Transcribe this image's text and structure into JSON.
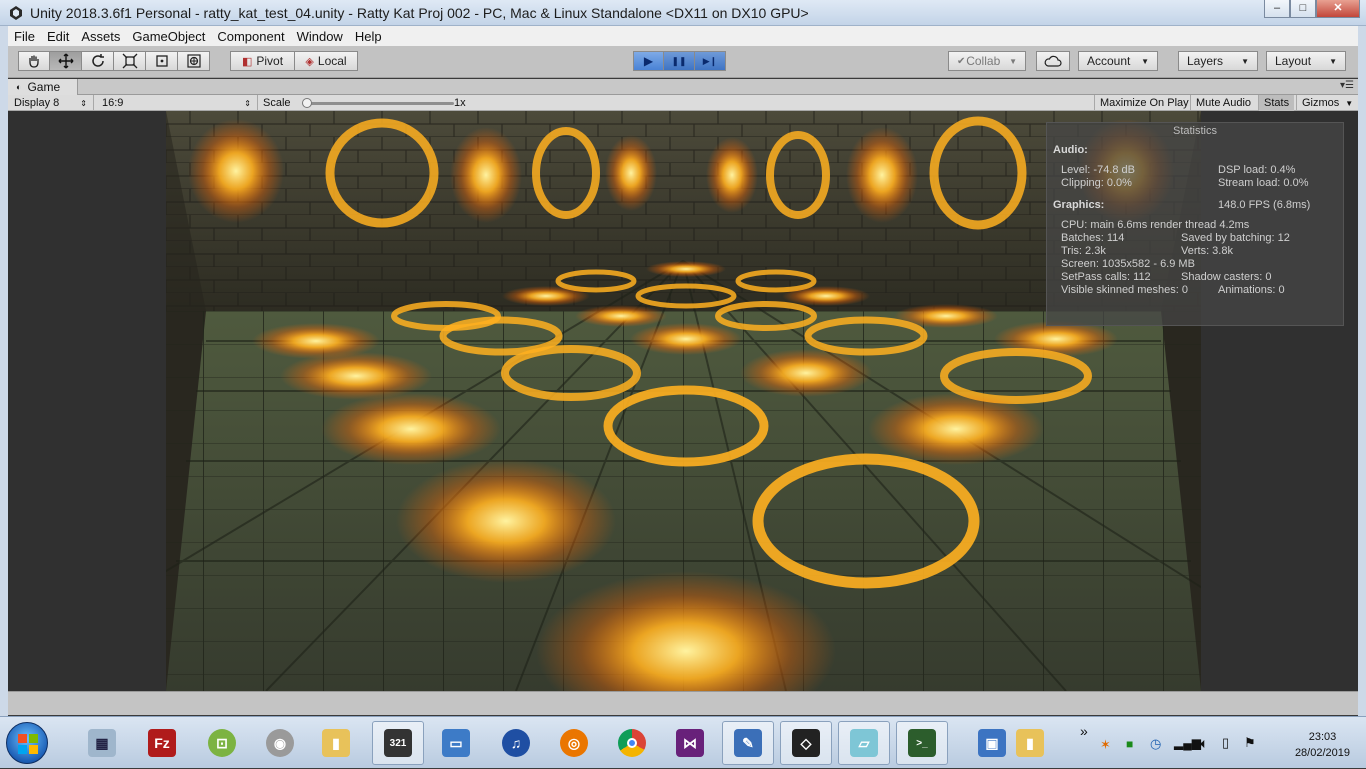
{
  "window": {
    "title": "Unity 2018.3.6f1 Personal - ratty_kat_test_04.unity - Ratty Kat Proj 002 - PC, Mac & Linux Standalone <DX11 on DX10 GPU>",
    "minimize": "–",
    "maximize": "□",
    "close": "✕"
  },
  "menu": [
    "File",
    "Edit",
    "Assets",
    "GameObject",
    "Component",
    "Window",
    "Help"
  ],
  "toolbar": {
    "pivot_label": "Pivot",
    "local_label": "Local",
    "collab_label": "Collab",
    "account_label": "Account",
    "layers_label": "Layers",
    "layout_label": "Layout",
    "play_icon": "▶",
    "pause_icon": "❚❚",
    "step_icon": "▶❙"
  },
  "game_tab": {
    "tab_label": "Game",
    "display": "Display 8",
    "aspect": "16:9",
    "scale_label": "Scale",
    "scale_value": "1x",
    "maximize_on_play": "Maximize On Play",
    "mute_audio": "Mute Audio",
    "stats": "Stats",
    "gizmos": "Gizmos"
  },
  "stats": {
    "title": "Statistics",
    "audio_header": "Audio:",
    "level": "Level: -74.8 dB",
    "dsp_load": "DSP load: 0.4%",
    "clipping": "Clipping: 0.0%",
    "stream_load": "Stream load: 0.0%",
    "graphics_header": "Graphics:",
    "fps": "148.0 FPS (6.8ms)",
    "cpu": "CPU: main 6.6ms  render thread 4.2ms",
    "batches": "Batches: 114",
    "saved_batching": "Saved by batching: 12",
    "tris": "Tris: 2.3k",
    "verts": "Verts: 3.8k",
    "screen": "Screen: 1035x582 - 6.9 MB",
    "setpass": "SetPass calls: 112",
    "shadow_casters": "Shadow casters: 0",
    "skinned": "Visible skinned meshes: 0",
    "animations": "Animations: 0"
  },
  "taskbar": {
    "apps": [
      "calculator",
      "filezilla",
      "android-sdk",
      "speaker",
      "folder",
      "clapper",
      "remote-desktop",
      "headphones",
      "blender",
      "chrome",
      "visual-studio",
      "paint",
      "unity",
      "notepad",
      "terminal",
      "monitor",
      "folder-2"
    ],
    "tray_overflow": "»",
    "time": "23:03",
    "date": "28/02/2019"
  },
  "colors": {
    "rune_glow": "#ffb020",
    "accent_play": "#4a83d6"
  }
}
